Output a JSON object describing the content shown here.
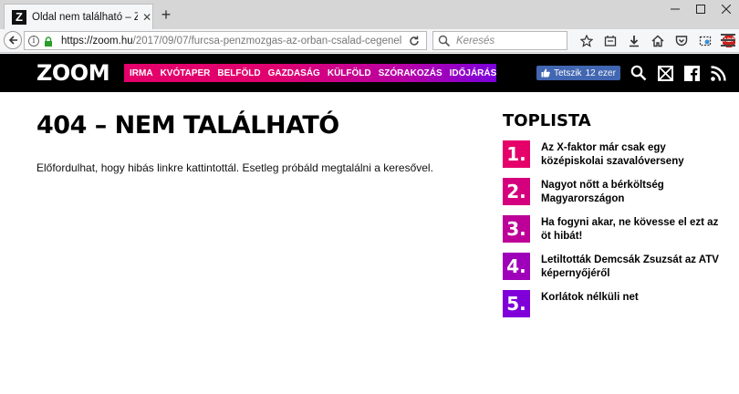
{
  "browser": {
    "tab_title": "Oldal nem található – Zoom",
    "tab_favicon": "Z",
    "url_host": "https://zoom.hu",
    "url_path": "/2017/09/07/furcsa-penzmozgas-az-orban-csalad-cegenel",
    "search_placeholder": "Keresés",
    "adblock_label": "ABP"
  },
  "site": {
    "logo": "ZOOM",
    "menu": [
      "IRMA",
      "KVÓTAPER",
      "BELFÖLD",
      "GAZDASÁG",
      "KÜLFÖLD",
      "SZÓRAKOZÁS",
      "IDŐJÁRÁS"
    ],
    "fb_like_label": "Tetszik",
    "fb_like_count": "12 ezer"
  },
  "main": {
    "title": "404 – NEM TALÁLHATÓ",
    "description": "Előfordulhat, hogy hibás linkre kattintottál. Esetleg próbáld megtalálni a keresővel."
  },
  "toplist": {
    "title": "TOPLISTA",
    "items": [
      {
        "rank": "1.",
        "text": "Az X-faktor már csak egy középiskolai szavalóverseny",
        "color": "#e5006a"
      },
      {
        "rank": "2.",
        "text": "Nagyot nőtt a bérköltség Magyarországon",
        "color": "#d4007d"
      },
      {
        "rank": "3.",
        "text": "Ha fogyni akar, ne kövesse el ezt az öt hibát!",
        "color": "#bd0097"
      },
      {
        "rank": "4.",
        "text": "Letiltották Demcsák Zsuzsát az ATV képernyőjéről",
        "color": "#9f00b9"
      },
      {
        "rank": "5.",
        "text": "Korlátok nélküli net",
        "color": "#7f00d8"
      }
    ]
  }
}
